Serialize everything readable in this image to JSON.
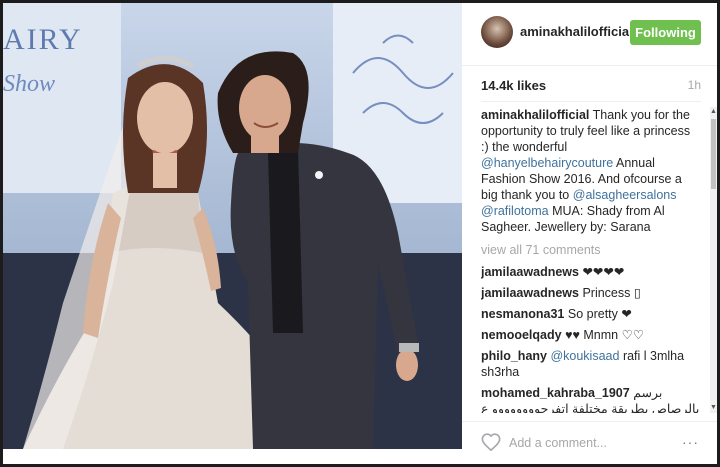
{
  "photo": {
    "brand_text": "AIRY",
    "brand_sub": "Show"
  },
  "post": {
    "username": "aminakhalilofficial",
    "follow_label": "Following",
    "likes": "14.4k likes",
    "time": "1h",
    "caption": {
      "user": "aminakhalilofficial",
      "text1": "Thank you for the opportunity to truly feel like a princess :) the wonderful",
      "mention1": "@hanyelbehairycouture",
      "text2": "Annual Fashion Show 2016. And ofcourse a big thank you to",
      "mention2": "@alsagheersalons",
      "mention3": "@rafilotoma",
      "text3": "MUA: Shady from Al Sagheer. Jewellery by: Sarana"
    },
    "view_all": "view all 71 comments",
    "comments": [
      {
        "user": "jamilaawadnews",
        "text": "❤❤❤❤"
      },
      {
        "user": "jamilaawadnews",
        "text": "Princess ▯"
      },
      {
        "user": "nesmanona31",
        "text": "So pretty ❤"
      },
      {
        "user": "nemooelqady",
        "text": "♥♥ Mnmn ♡♡"
      },
      {
        "user": "philo_hany",
        "mention": "@koukisaad",
        "text": "rafi l 3mlha sh3rha"
      },
      {
        "user": "mohamed_kahraba_1907",
        "text": "برسم بالرصاص بطريقة مختلفة اتفرجوووووووو ع شغلي يا!!!!!!!الرب يمجبكوووووووووو ❤"
      }
    ],
    "add_comment_placeholder": "Add a comment...",
    "more_icon": "···"
  },
  "icons": {
    "heart": "heart-icon",
    "more": "more-icon",
    "scroll_up": "▲",
    "scroll_down": "▼"
  },
  "colors": {
    "follow_button": "#70c050",
    "mention": "#3f729b",
    "muted": "#a5a7aa"
  }
}
